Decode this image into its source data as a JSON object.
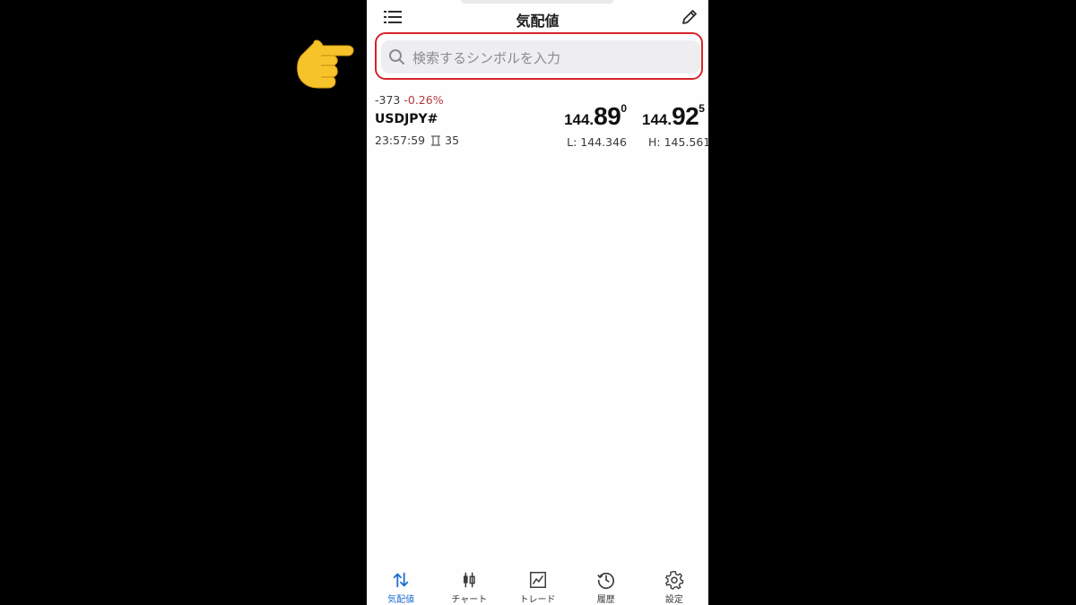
{
  "header": {
    "title": "気配値"
  },
  "search": {
    "placeholder": "検索するシンボルを入力"
  },
  "quotes": [
    {
      "change": "-373",
      "change_pct": "-0.26%",
      "symbol": "USDJPY#",
      "time": "23:57:59",
      "spread": "35",
      "bid": {
        "prefix": "144.",
        "main": "89",
        "pip": "0"
      },
      "ask": {
        "prefix": "144.",
        "main": "92",
        "pip": "5"
      },
      "low": "L: 144.346",
      "high": "H: 145.561"
    }
  ],
  "tabs": [
    {
      "label": "気配値",
      "icon": "arrows-updown-icon",
      "active": true
    },
    {
      "label": "チャート",
      "icon": "candlestick-icon",
      "active": false
    },
    {
      "label": "トレード",
      "icon": "trade-chart-icon",
      "active": false
    },
    {
      "label": "履歴",
      "icon": "history-icon",
      "active": false
    },
    {
      "label": "設定",
      "icon": "gear-icon",
      "active": false
    }
  ],
  "colors": {
    "accent": "#1f6fd1",
    "negative": "#b5383d",
    "highlight": "#d8232a",
    "hand": "#f6c32b"
  }
}
